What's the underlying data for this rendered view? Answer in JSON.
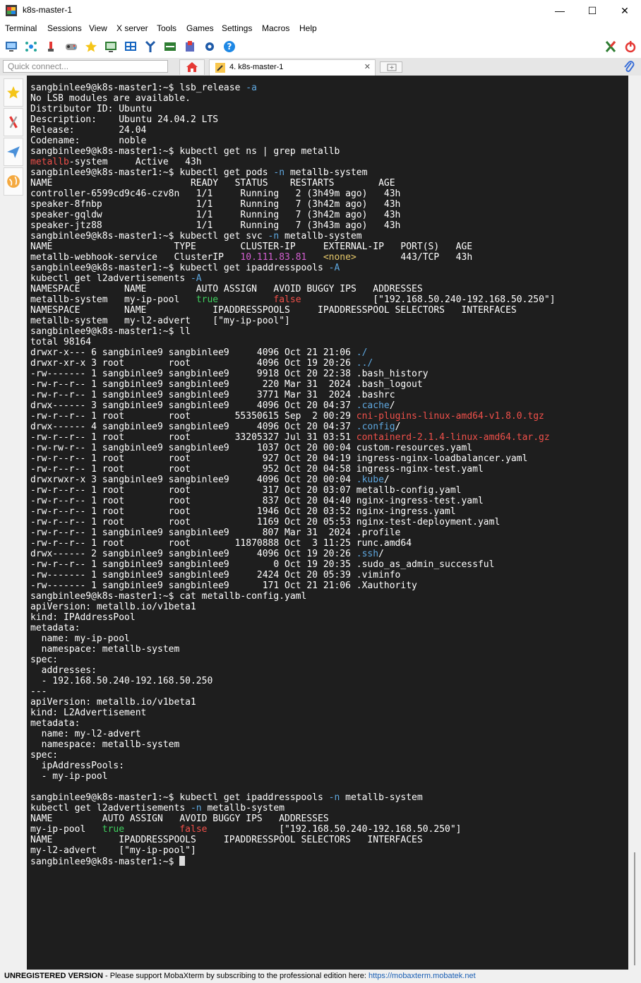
{
  "window": {
    "title": "k8s-master-1",
    "minimize_glyph": "—",
    "maximize_glyph": "☐",
    "close_glyph": "✕"
  },
  "menu": {
    "items": [
      "Terminal",
      "Sessions",
      "View",
      "X server",
      "Tools",
      "Games",
      "Settings",
      "Macros",
      "Help"
    ]
  },
  "toolbar": {
    "icons": [
      "session-icon",
      "servers-icon",
      "tools-icon",
      "games-icon",
      "sessions-star-icon",
      "view-icon",
      "split-icon",
      "multiexec-icon",
      "tunneling-icon",
      "packages-icon",
      "settings-icon",
      "help-icon",
      "xserver-icon",
      "exit-icon"
    ]
  },
  "tabs": {
    "quick_connect_placeholder": "Quick connect...",
    "session_tab_label": "4. k8s-master-1",
    "close_glyph": "✕"
  },
  "sidebar": {
    "icons": [
      "favorites-star-icon",
      "tools-icon",
      "send-icon",
      "globe-icon"
    ]
  },
  "terminal": {
    "lines": [
      [
        {
          "t": "sangbinlee9@k8s-master1:~$ lsb_release "
        },
        {
          "t": "-a",
          "c": "#5fa8e0"
        }
      ],
      [
        {
          "t": "No LSB modules are available."
        }
      ],
      [
        {
          "t": "Distributor ID: Ubuntu"
        }
      ],
      [
        {
          "t": "Description:    Ubuntu 24.04.2 LTS"
        }
      ],
      [
        {
          "t": "Release:        24.04"
        }
      ],
      [
        {
          "t": "Codename:       noble"
        }
      ],
      [
        {
          "t": "sangbinlee9@k8s-master1:~$ kubectl get ns | grep metallb"
        }
      ],
      [
        {
          "t": "metallb",
          "c": "#f0504a"
        },
        {
          "t": "-system     Active   43h"
        }
      ],
      [
        {
          "t": "sangbinlee9@k8s-master1:~$ kubectl get pods "
        },
        {
          "t": "-n",
          "c": "#5fa8e0"
        },
        {
          "t": " metallb-system"
        }
      ],
      [
        {
          "t": "NAME                         READY   STATUS    RESTARTS        AGE"
        }
      ],
      [
        {
          "t": "controller-6599cd9c46-czv8n   1/1     Running   2 (3h49m ago)   43h"
        }
      ],
      [
        {
          "t": "speaker-8fnbp                 1/1     Running   7 (3h42m ago)   43h"
        }
      ],
      [
        {
          "t": "speaker-gqldw                 1/1     Running   7 (3h42m ago)   43h"
        }
      ],
      [
        {
          "t": "speaker-jtz88                 1/1     Running   7 (3h43m ago)   43h"
        }
      ],
      [
        {
          "t": "sangbinlee9@k8s-master1:~$ kubectl get svc "
        },
        {
          "t": "-n",
          "c": "#5fa8e0"
        },
        {
          "t": " metallb-system"
        }
      ],
      [
        {
          "t": "NAME                      TYPE        CLUSTER-IP     EXTERNAL-IP   PORT(S)   AGE"
        }
      ],
      [
        {
          "t": "metallb-webhook-service   ClusterIP   "
        },
        {
          "t": "10.111.83.81",
          "c": "#d35fd0"
        },
        {
          "t": "   "
        },
        {
          "t": "<none>",
          "c": "#e6c86a"
        },
        {
          "t": "        443/TCP   43h"
        }
      ],
      [
        {
          "t": "sangbinlee9@k8s-master1:~$ kubectl get ipaddresspools "
        },
        {
          "t": "-A",
          "c": "#5fa8e0"
        }
      ],
      [
        {
          "t": "kubectl get l2advertisements "
        },
        {
          "t": "-A",
          "c": "#5fa8e0"
        }
      ],
      [
        {
          "t": "NAMESPACE        NAME         AUTO ASSIGN   AVOID BUGGY IPS   ADDRESSES"
        }
      ],
      [
        {
          "t": "metallb-system   my-ip-pool   "
        },
        {
          "t": "true",
          "c": "#3fcf5e"
        },
        {
          "t": "          "
        },
        {
          "t": "false",
          "c": "#f0504a"
        },
        {
          "t": "             [\"192.168.50.240-192.168.50.250\"]"
        }
      ],
      [
        {
          "t": "NAMESPACE        NAME            IPADDRESSPOOLS     IPADDRESSPOOL SELECTORS   INTERFACES"
        }
      ],
      [
        {
          "t": "metallb-system   my-l2-advert    [\"my-ip-pool\"]"
        }
      ],
      [
        {
          "t": "sangbinlee9@k8s-master1:~$ ll"
        }
      ],
      [
        {
          "t": "total 98164"
        }
      ],
      [
        {
          "t": "drwxr-x--- 6 sangbinlee9 sangbinlee9     4096 Oct 21 21:06 "
        },
        {
          "t": "./",
          "c": "#5fa8e0"
        }
      ],
      [
        {
          "t": "drwxr-xr-x 3 root        root            4096 Oct 19 20:26 "
        },
        {
          "t": "../",
          "c": "#5fa8e0"
        }
      ],
      [
        {
          "t": "-rw------- 1 sangbinlee9 sangbinlee9     9918 Oct 20 22:38 .bash_history"
        }
      ],
      [
        {
          "t": "-rw-r--r-- 1 sangbinlee9 sangbinlee9      220 Mar 31  2024 .bash_logout"
        }
      ],
      [
        {
          "t": "-rw-r--r-- 1 sangbinlee9 sangbinlee9     3771 Mar 31  2024 .bashrc"
        }
      ],
      [
        {
          "t": "drwx------ 3 sangbinlee9 sangbinlee9     4096 Oct 20 04:37 "
        },
        {
          "t": ".cache",
          "c": "#5fa8e0"
        },
        {
          "t": "/"
        }
      ],
      [
        {
          "t": "-rw-r--r-- 1 root        root        55350615 Sep  2 00:29 "
        },
        {
          "t": "cni-plugins-linux-amd64-v1.8.0.tgz",
          "c": "#f0504a"
        }
      ],
      [
        {
          "t": "drwx------ 4 sangbinlee9 sangbinlee9     4096 Oct 20 04:37 "
        },
        {
          "t": ".config",
          "c": "#5fa8e0"
        },
        {
          "t": "/"
        }
      ],
      [
        {
          "t": "-rw-r--r-- 1 root        root        33205327 Jul 31 03:51 "
        },
        {
          "t": "containerd-2.1.4-linux-amd64.tar.gz",
          "c": "#f0504a"
        }
      ],
      [
        {
          "t": "-rw-rw-r-- 1 sangbinlee9 sangbinlee9     1037 Oct 20 00:04 custom-resources.yaml"
        }
      ],
      [
        {
          "t": "-rw-r--r-- 1 root        root             927 Oct 20 04:19 ingress-nginx-loadbalancer.yaml"
        }
      ],
      [
        {
          "t": "-rw-r--r-- 1 root        root             952 Oct 20 04:58 ingress-nginx-test.yaml"
        }
      ],
      [
        {
          "t": "drwxrwxr-x 3 sangbinlee9 sangbinlee9     4096 Oct 20 00:04 "
        },
        {
          "t": ".kube",
          "c": "#5fa8e0"
        },
        {
          "t": "/"
        }
      ],
      [
        {
          "t": "-rw-r--r-- 1 root        root             317 Oct 20 03:07 metallb-config.yaml"
        }
      ],
      [
        {
          "t": "-rw-r--r-- 1 root        root             837 Oct 20 04:40 nginx-ingress-test.yaml"
        }
      ],
      [
        {
          "t": "-rw-r--r-- 1 root        root            1946 Oct 20 03:52 nginx-ingress.yaml"
        }
      ],
      [
        {
          "t": "-rw-r--r-- 1 root        root            1169 Oct 20 05:53 nginx-test-deployment.yaml"
        }
      ],
      [
        {
          "t": "-rw-r--r-- 1 sangbinlee9 sangbinlee9      807 Mar 31  2024 .profile"
        }
      ],
      [
        {
          "t": "-rw-r--r-- 1 root        root        11870888 Oct  3 11:25 runc.amd64"
        }
      ],
      [
        {
          "t": "drwx------ 2 sangbinlee9 sangbinlee9     4096 Oct 19 20:26 "
        },
        {
          "t": ".ssh",
          "c": "#5fa8e0"
        },
        {
          "t": "/"
        }
      ],
      [
        {
          "t": "-rw-r--r-- 1 sangbinlee9 sangbinlee9        0 Oct 19 20:35 .sudo_as_admin_successful"
        }
      ],
      [
        {
          "t": "-rw------- 1 sangbinlee9 sangbinlee9     2424 Oct 20 05:39 .viminfo"
        }
      ],
      [
        {
          "t": "-rw------- 1 sangbinlee9 sangbinlee9      171 Oct 21 21:06 .Xauthority"
        }
      ],
      [
        {
          "t": "sangbinlee9@k8s-master1:~$ cat metallb-config.yaml"
        }
      ],
      [
        {
          "t": "apiVersion: metallb.io/v1beta1"
        }
      ],
      [
        {
          "t": "kind: IPAddressPool"
        }
      ],
      [
        {
          "t": "metadata:"
        }
      ],
      [
        {
          "t": "  name: my-ip-pool"
        }
      ],
      [
        {
          "t": "  namespace: metallb-system"
        }
      ],
      [
        {
          "t": "spec:"
        }
      ],
      [
        {
          "t": "  addresses:"
        }
      ],
      [
        {
          "t": "  - 192.168.50.240-192.168.50.250"
        }
      ],
      [
        {
          "t": "---"
        }
      ],
      [
        {
          "t": "apiVersion: metallb.io/v1beta1"
        }
      ],
      [
        {
          "t": "kind: L2Advertisement"
        }
      ],
      [
        {
          "t": "metadata:"
        }
      ],
      [
        {
          "t": "  name: my-l2-advert"
        }
      ],
      [
        {
          "t": "  namespace: metallb-system"
        }
      ],
      [
        {
          "t": "spec:"
        }
      ],
      [
        {
          "t": "  ipAddressPools:"
        }
      ],
      [
        {
          "t": "  - my-ip-pool"
        }
      ],
      [
        {
          "t": ""
        }
      ],
      [
        {
          "t": "sangbinlee9@k8s-master1:~$ kubectl get ipaddresspools "
        },
        {
          "t": "-n",
          "c": "#5fa8e0"
        },
        {
          "t": " metallb-system"
        }
      ],
      [
        {
          "t": "kubectl get l2advertisements "
        },
        {
          "t": "-n",
          "c": "#5fa8e0"
        },
        {
          "t": " metallb-system"
        }
      ],
      [
        {
          "t": "NAME         AUTO ASSIGN   AVOID BUGGY IPS   ADDRESSES"
        }
      ],
      [
        {
          "t": "my-ip-pool   "
        },
        {
          "t": "true",
          "c": "#3fcf5e"
        },
        {
          "t": "          "
        },
        {
          "t": "false",
          "c": "#f0504a"
        },
        {
          "t": "             [\"192.168.50.240-192.168.50.250\"]"
        }
      ],
      [
        {
          "t": "NAME            IPADDRESSPOOLS     IPADDRESSPOOL SELECTORS   INTERFACES"
        }
      ],
      [
        {
          "t": "my-l2-advert    [\"my-ip-pool\"]"
        }
      ],
      [
        {
          "t": "sangbinlee9@k8s-master1:~$ "
        },
        {
          "cursor": true
        }
      ]
    ]
  },
  "status": {
    "unregistered": "UNREGISTERED VERSION",
    "message": "  -  Please support MobaXterm by subscribing to the professional edition here:  ",
    "link": "https://mobaxterm.mobatek.net"
  }
}
